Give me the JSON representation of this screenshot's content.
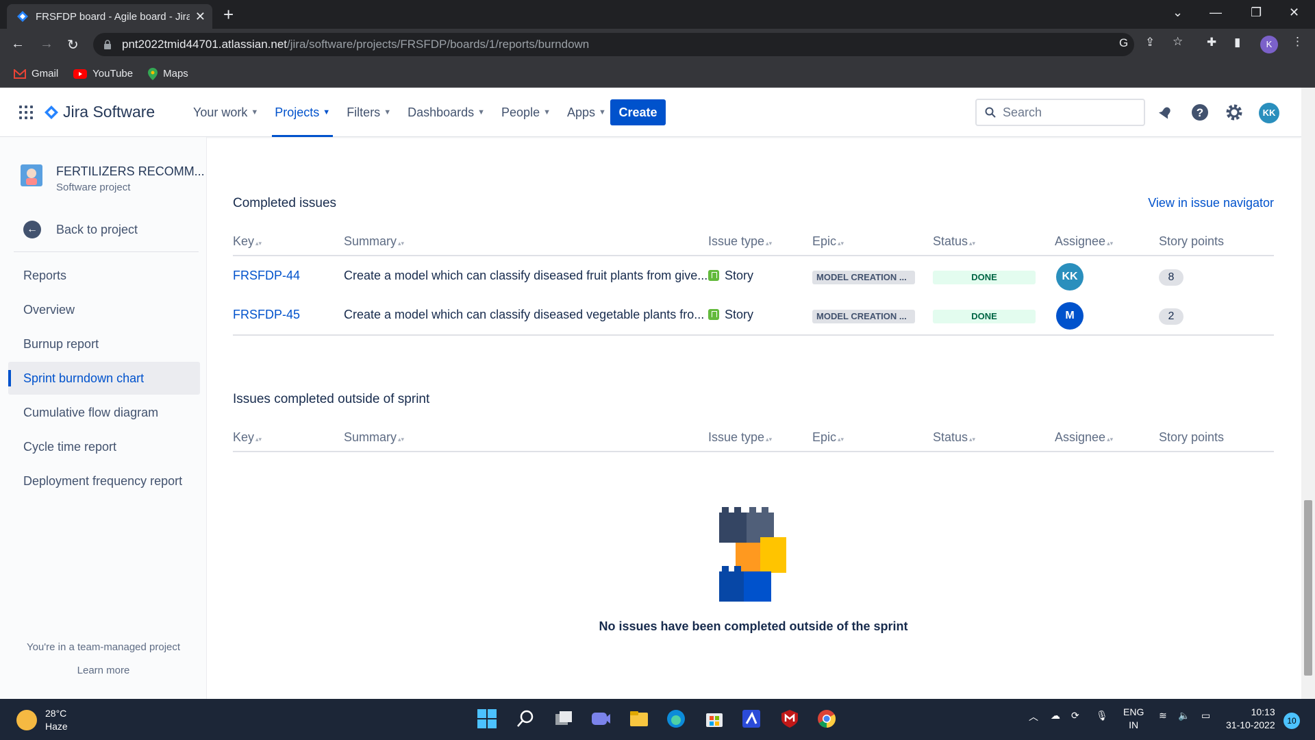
{
  "browser": {
    "tab_title": "FRSFDP board - Agile board - Jira",
    "url_host": "pnt2022tmid44701.atlassian.net",
    "url_path": "/jira/software/projects/FRSFDP/boards/1/reports/burndown",
    "profile_initial": "K",
    "bookmarks": [
      {
        "label": "Gmail",
        "icon": "gmail-icon",
        "color": "#EA4335"
      },
      {
        "label": "YouTube",
        "icon": "youtube-icon",
        "color": "#FF0000"
      },
      {
        "label": "Maps",
        "icon": "maps-icon",
        "color": "#34A853"
      }
    ]
  },
  "jira": {
    "product": "Jira Software",
    "nav": [
      "Your work",
      "Projects",
      "Filters",
      "Dashboards",
      "People",
      "Apps"
    ],
    "active_nav": "Projects",
    "create_label": "Create",
    "search_placeholder": "Search",
    "user_initials": "KK",
    "accent": "#0052CC"
  },
  "sidebar": {
    "project_name": "FERTILIZERS RECOMM...",
    "project_type": "Software project",
    "back_label": "Back to project",
    "reports_heading": "Reports",
    "items": [
      "Overview",
      "Burnup report",
      "Sprint burndown chart",
      "Cumulative flow diagram",
      "Cycle time report",
      "Deployment frequency report"
    ],
    "active_item": "Sprint burndown chart",
    "footer_text": "You're in a team-managed project",
    "footer_link": "Learn more"
  },
  "completed": {
    "title": "Completed issues",
    "navigator_link": "View in issue navigator",
    "columns": [
      "Key",
      "Summary",
      "Issue type",
      "Epic",
      "Status",
      "Assignee",
      "Story points"
    ],
    "rows": [
      {
        "key": "FRSFDP-44",
        "summary": "Create a model which can classify diseased fruit plants from give...",
        "type": "Story",
        "epic": "MODEL CREATION ...",
        "status": "DONE",
        "assignee": "KK",
        "assignee_color": "#2a8fbd",
        "points": "8"
      },
      {
        "key": "FRSFDP-45",
        "summary": "Create a model which can classify diseased vegetable plants fro...",
        "type": "Story",
        "epic": "MODEL CREATION ...",
        "status": "DONE",
        "assignee": "M",
        "assignee_color": "#0052CC",
        "points": "2"
      }
    ]
  },
  "outside": {
    "title": "Issues completed outside of sprint",
    "columns": [
      "Key",
      "Summary",
      "Issue type",
      "Epic",
      "Status",
      "Assignee",
      "Story points"
    ],
    "empty_message": "No issues have been completed outside of the sprint"
  },
  "taskbar": {
    "temperature": "28°C",
    "weather": "Haze",
    "language": "ENG",
    "region": "IN",
    "time": "10:13",
    "date": "31-10-2022",
    "notifications": "10"
  }
}
